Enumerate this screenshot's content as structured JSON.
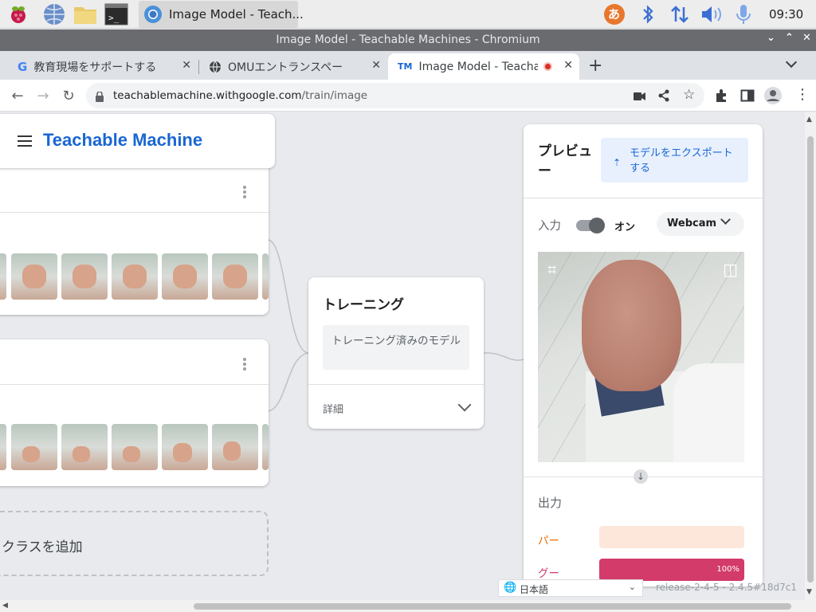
{
  "taskbar": {
    "active_task": "Image Model - Teach...",
    "clock": "09:30",
    "ime_label": "あ"
  },
  "window": {
    "title": "Image Model - Teachable Machines - Chromium"
  },
  "tabs": [
    {
      "title": "教育現場をサポートする",
      "icon": "google-icon"
    },
    {
      "title": "OMUエントランスペー",
      "icon": "globe-icon"
    },
    {
      "title": "Image Model - Teacha",
      "icon": "teachable-machine-icon",
      "active": true,
      "recording": true
    }
  ],
  "toolbar": {
    "url_host": "teachablemachine.withgoogle.com",
    "url_path": "/train/image"
  },
  "app": {
    "brand": "Teachable Machine",
    "add_class": "クラスを追加",
    "training": {
      "title": "トレーニング",
      "button": "トレーニング済みのモデル",
      "details": "詳細"
    },
    "preview": {
      "title": "プレビュー",
      "export": "モデルをエクスポートする",
      "input_label": "入力",
      "toggle_state": "オン",
      "source": "Webcam",
      "output_label": "出力",
      "classes": [
        {
          "name": "パー",
          "value": 0,
          "color": "#e8710a",
          "bar_bg": "#fde7da"
        },
        {
          "name": "グー",
          "value": 100,
          "value_text": "100%",
          "color": "#d33b6a",
          "bar_bg": "#d33b6a"
        }
      ]
    }
  },
  "footer": {
    "language": "日本語",
    "release": "release-2-4-5 - 2.4.5#18d7c1"
  }
}
